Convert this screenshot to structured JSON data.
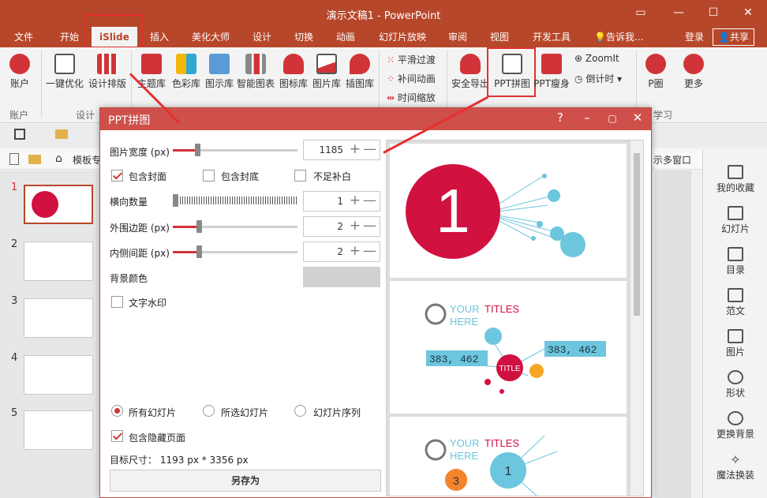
{
  "window": {
    "title": "演示文稿1 - PowerPoint"
  },
  "tabs": [
    "文件",
    "开始",
    "iSlide",
    "插入",
    "美化大师",
    "设计",
    "切换",
    "动画",
    "幻灯片放映",
    "审阅",
    "视图",
    "开发工具"
  ],
  "tellme": "告诉我...",
  "account": {
    "login": "登录",
    "share": "共享"
  },
  "ribbon": {
    "account_btn": "账户",
    "group_account": "账户",
    "yijian": "一键优化",
    "sheji": "设计排版",
    "group_design": "设计",
    "lib": [
      "主题库",
      "色彩库",
      "图示库",
      "智能图表",
      "图标库",
      "图片库",
      "插图库"
    ],
    "anim": [
      "平滑过渡",
      "补间动画",
      "时间缩放"
    ],
    "anquan": "安全导出",
    "pinjie": "PPT拼图",
    "shou": "PPT瘦身",
    "zoomit": "ZoomIt",
    "daojishi": "倒计时",
    "pquan": "P圈",
    "more": "更多",
    "group_learn": "学习"
  },
  "navbar": {
    "template": "模板专",
    "multi": "示多窗口"
  },
  "slides": [
    "1",
    "2",
    "3",
    "4",
    "5"
  ],
  "rightpane": [
    "我的收藏",
    "幻灯片",
    "目录",
    "范文",
    "图片",
    "形状",
    "更换背景",
    "魔法换装"
  ],
  "dialog": {
    "title": "PPT拼图",
    "width_label": "图片宽度 (px)",
    "width_value": "1185",
    "inc_cover": "包含封面",
    "inc_back": "包含封底",
    "pad": "不足补白",
    "cols_label": "横向数量",
    "cols_value": "1",
    "outer_label": "外围边距 (px)",
    "outer_value": "2",
    "inner_label": "内侧间距 (px)",
    "inner_value": "2",
    "bg_label": "背景颜色",
    "watermark": "文字水印",
    "r_all": "所有幻灯片",
    "r_sel": "所选幻灯片",
    "r_seq": "幻灯片序列",
    "hidden": "包含隐藏页面",
    "target_label": "目标尺寸：",
    "target_value": "1193 px *  3356 px",
    "save": "另存为"
  },
  "preview": {
    "big_num": "1",
    "your": "YOUR",
    "titles": "TITLES",
    "here": "HERE",
    "num1": "383, 462",
    "num2": "383, 462",
    "title_chip": "TITLE",
    "num3": "1",
    "num4": "3"
  },
  "colors": {
    "accent": "#b7472a",
    "red": "#d1113f",
    "cyan": "#6cc6dd"
  }
}
